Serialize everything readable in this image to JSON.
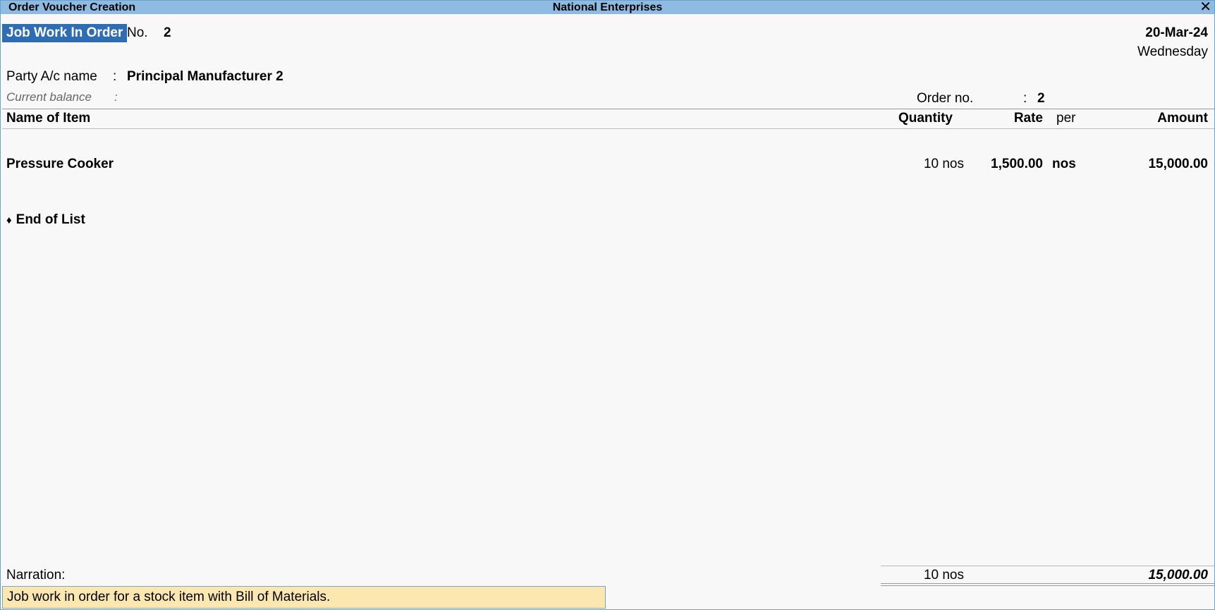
{
  "window": {
    "title": "Order Voucher Creation",
    "company": "National Enterprises",
    "close_icon": "close-icon"
  },
  "voucher": {
    "type": "Job Work In Order",
    "no_label": "No.",
    "no_value": "2",
    "date": "20-Mar-24",
    "day": "Wednesday"
  },
  "party": {
    "label": "Party A/c name",
    "colon": ":",
    "value": "Principal Manufacturer 2"
  },
  "balance": {
    "label": "Current balance",
    "colon": ":"
  },
  "order": {
    "label": "Order no.",
    "colon": ":",
    "value": "2"
  },
  "table": {
    "headers": {
      "name": "Name of Item",
      "quantity": "Quantity",
      "rate": "Rate",
      "per": "per",
      "amount": "Amount"
    },
    "rows": [
      {
        "name": "Pressure Cooker",
        "quantity": "10 nos",
        "rate": "1,500.00",
        "per": "nos",
        "amount": "15,000.00"
      }
    ],
    "end_of_list": "End of List"
  },
  "totals": {
    "quantity": "10 nos",
    "amount": "15,000.00"
  },
  "narration": {
    "label": "Narration:",
    "value": "Job work in order for a stock item with Bill of Materials."
  },
  "colors": {
    "titlebar": "#8ebbe1",
    "voucher_type_bg": "#2e6db4",
    "narration_bg": "#fde7b0"
  }
}
